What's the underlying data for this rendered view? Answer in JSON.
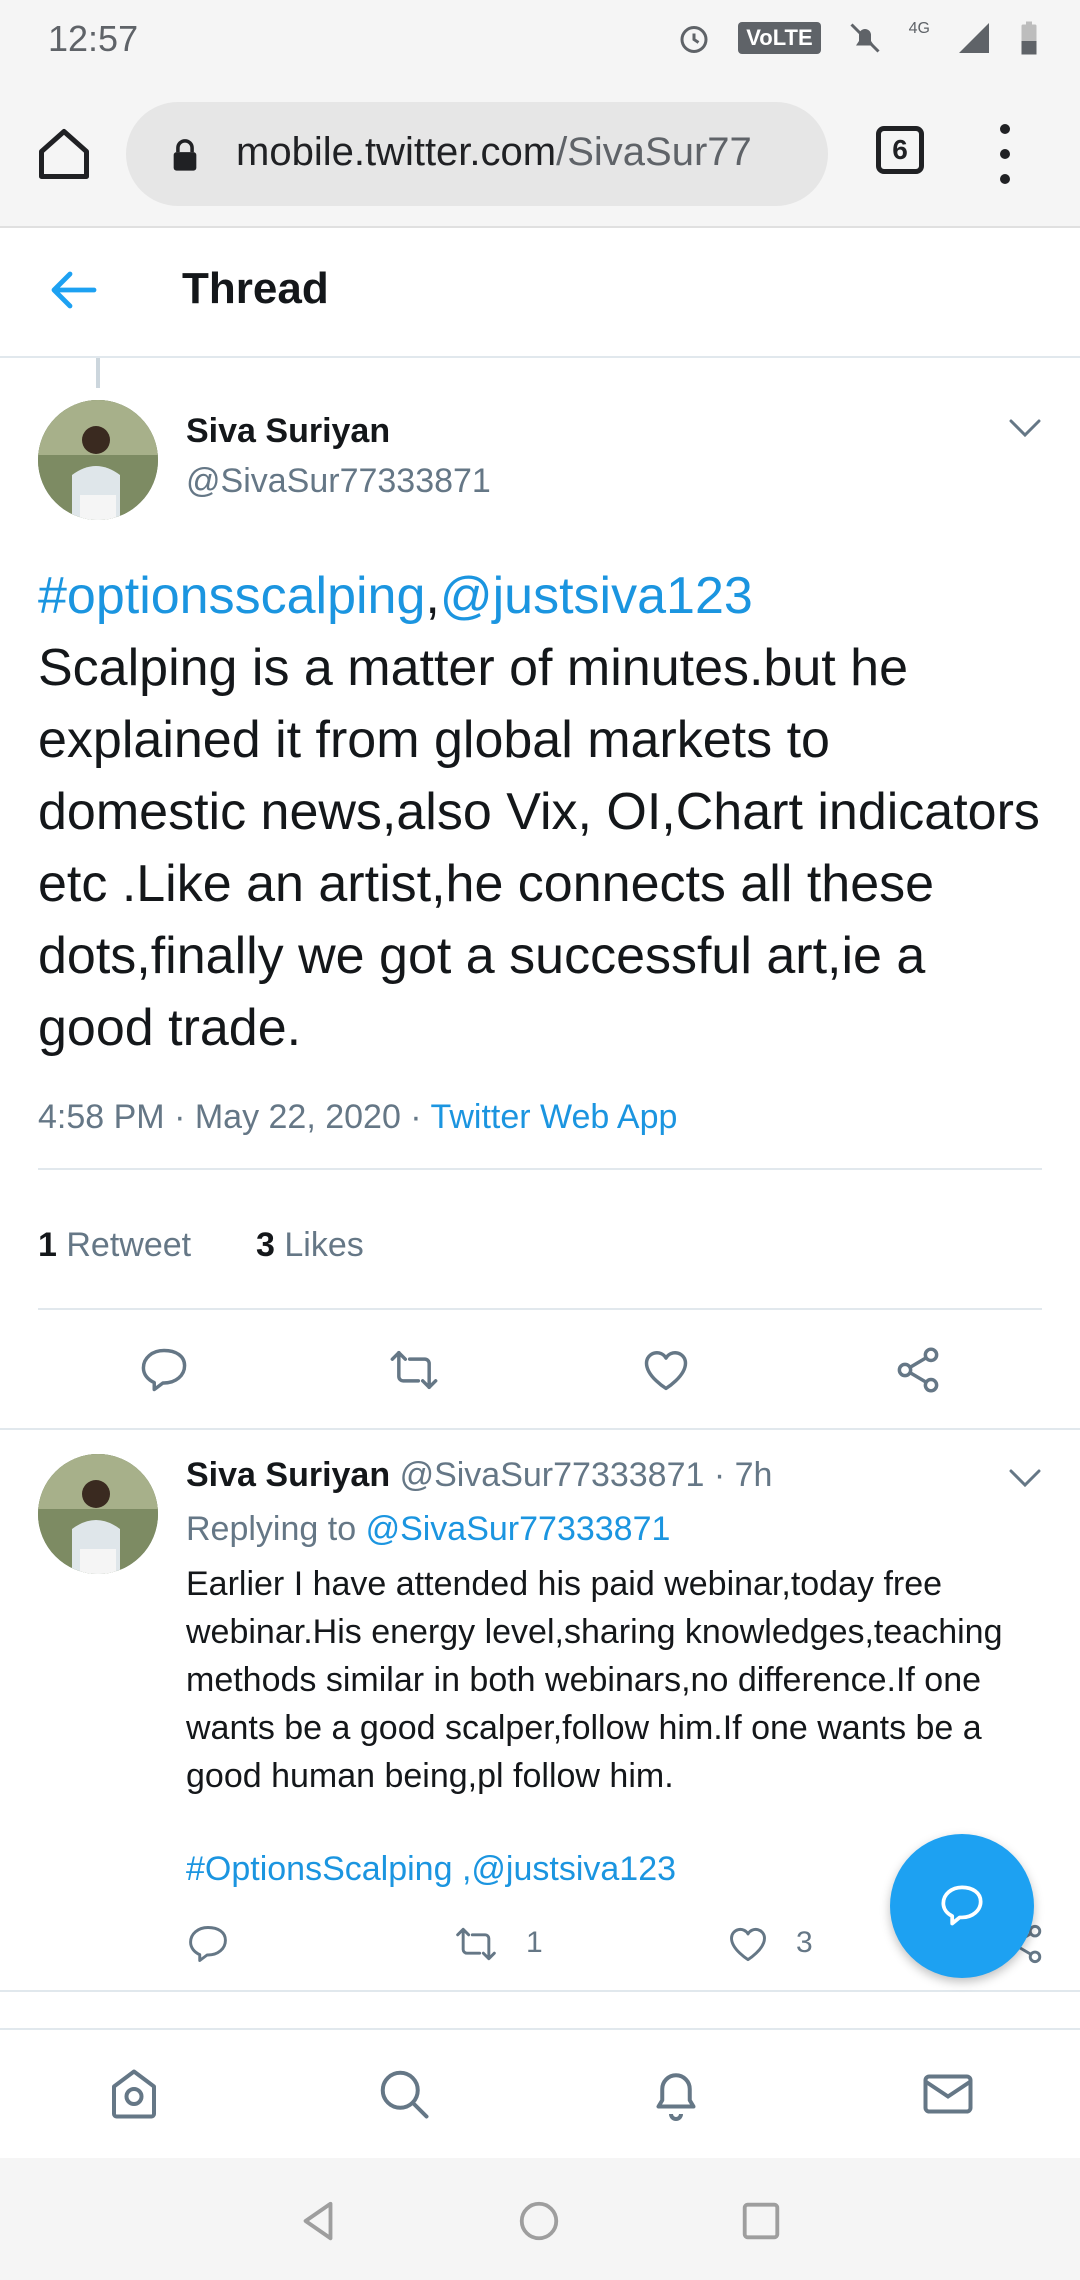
{
  "status_bar": {
    "time": "12:57",
    "volte": "VoLTE",
    "network": "4G"
  },
  "browser": {
    "url_host": "mobile.twitter.com",
    "url_path": "/SivaSur77",
    "tab_count": "6"
  },
  "thread": {
    "title": "Thread"
  },
  "main_tweet": {
    "name": "Siva Suriyan",
    "handle": "@SivaSur77333871",
    "hashtag": "#optionsscalping",
    "comma": ",",
    "mention": "@justsiva123",
    "text": "Scalping is a matter of minutes.but he explained it from global markets to domestic news,also Vix, OI,Chart indicators etc .Like an artist,he connects all these dots,finally we got a successful art,ie a good trade.",
    "time": "4:58 PM · May 22, 2020 · ",
    "source": "Twitter Web App",
    "retweets_count": "1",
    "retweets_label": "Retweet",
    "likes_count": "3",
    "likes_label": "Likes"
  },
  "reply_tweet": {
    "name": "Siva Suriyan",
    "handle": "@SivaSur77333871",
    "time": "· 7h",
    "replying_to_label": "Replying to",
    "replying_to_handle": "@SivaSur77333871",
    "text": "Earlier I have attended his paid webinar,today free webinar.His energy level,sharing knowledges,teaching methods similar in both webinars,no difference.If one wants be a good scalper,follow him.If one wants be a good human being,pl follow him.",
    "tags": "#OptionsScalping ,@justsiva123",
    "retweet_count": "1",
    "like_count": "3"
  },
  "icons": {
    "home": "home-icon",
    "search": "search-icon",
    "notifications": "bell-icon",
    "messages": "mail-icon",
    "reply": "reply-icon",
    "retweet": "retweet-icon",
    "like": "heart-icon",
    "share": "share-icon",
    "compose": "compose-icon"
  },
  "colors": {
    "accent": "#1da1f2",
    "link": "#1b95e0",
    "muted": "#657786",
    "text": "#14171a"
  }
}
